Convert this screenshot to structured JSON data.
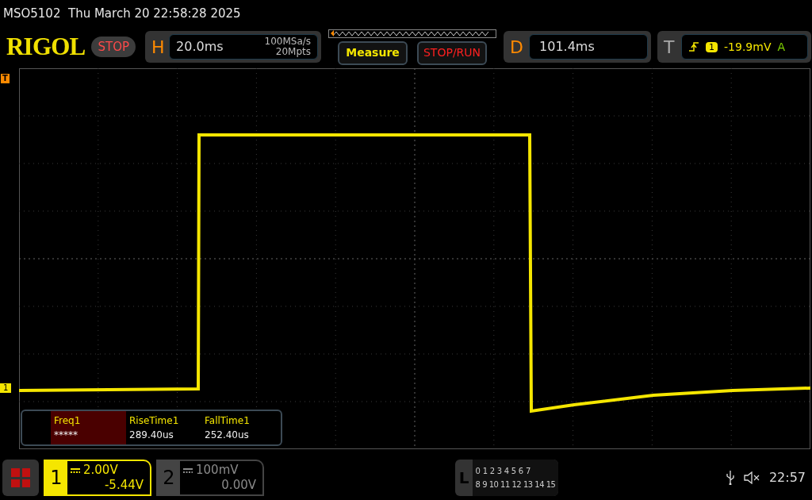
{
  "title": "MSO5102  Thu March 20 22:58:28 2025",
  "brand": "RIGOL",
  "run_state": "STOP",
  "horizontal": {
    "label": "H",
    "timebase": "20.0ms",
    "sample_rate": "100MSa/s",
    "memory_depth": "20Mpts"
  },
  "buttons": [
    {
      "label": "Measure",
      "kind": "measure"
    },
    {
      "label": "STOP/RUN",
      "kind": "run"
    }
  ],
  "delay": {
    "label": "D",
    "value": "101.4ms"
  },
  "trigger": {
    "label": "T",
    "source": "1",
    "level": "-19.9mV",
    "mode": "A"
  },
  "markers": {
    "trigger": "T",
    "channel": "1"
  },
  "measurements": [
    {
      "name": "Freq1",
      "value": "*****",
      "selected": true
    },
    {
      "name": "RiseTime1",
      "value": "289.40us",
      "selected": false
    },
    {
      "name": "FallTime1",
      "value": "252.40us",
      "selected": false
    }
  ],
  "channels": [
    {
      "number": "1",
      "scale": "2.00V",
      "offset": "-5.44V",
      "on": true
    },
    {
      "number": "2",
      "scale": "100mV",
      "offset": "0.00V",
      "on": false
    }
  ],
  "logic": {
    "label": "L",
    "row_1": [
      "0",
      "1",
      "2",
      "3",
      "4",
      "5",
      "6",
      "7"
    ],
    "row_2": [
      "8",
      "9",
      "10",
      "11",
      "12",
      "13",
      "14",
      "15"
    ]
  },
  "status": {
    "time": "22:57"
  }
}
